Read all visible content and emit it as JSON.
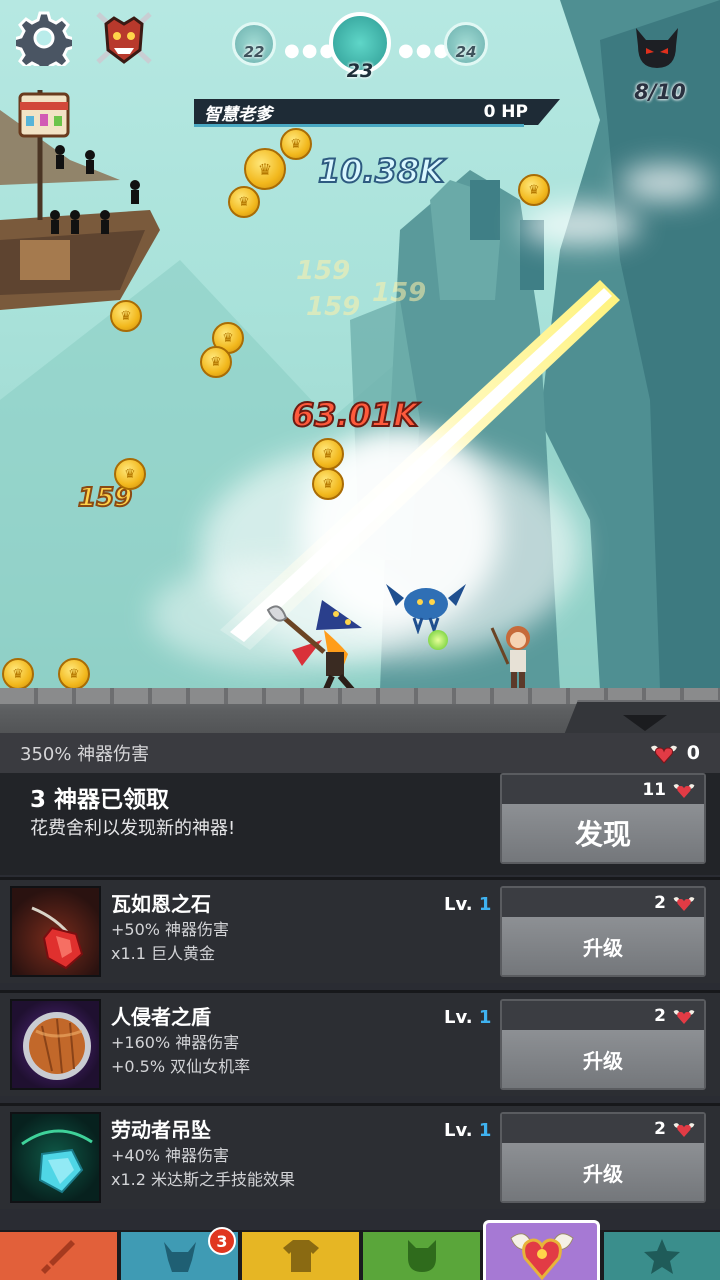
{
  "hud": {
    "stages": {
      "prev": "22",
      "current": "23",
      "next": "24"
    },
    "stage_progress": "8/10",
    "boss_name": "智慧老爹",
    "boss_hp": "0 HP"
  },
  "combat_text": {
    "top_damage": "10.38K",
    "crit_damage": "63.01K",
    "hit_damage": "159",
    "faded_hits": [
      "159",
      "159",
      "159"
    ]
  },
  "artifact_panel": {
    "damage_bonus": "350% 神器伤害",
    "relic_count": "0",
    "discover": {
      "title": "3 神器已领取",
      "subtitle": "花费舍利以发现新的神器!",
      "cost": "11",
      "button_label": "发现"
    },
    "artifacts": [
      {
        "name": "瓦如恩之石",
        "line1": "+50% 神器伤害",
        "line2": "x1.1 巨人黄金",
        "level_prefix": "Lv.",
        "level": "1",
        "cost": "2",
        "button_label": "升级"
      },
      {
        "name": "人侵者之盾",
        "line1": "+160% 神器伤害",
        "line2": "+0.5% 双仙女机率",
        "level_prefix": "Lv.",
        "level": "1",
        "cost": "2",
        "button_label": "升级"
      },
      {
        "name": "劳动者吊坠",
        "line1": "+40% 神器伤害",
        "line2": "x1.2 米达斯之手技能效果",
        "level_prefix": "Lv.",
        "level": "1",
        "cost": "2",
        "button_label": "升级"
      }
    ]
  },
  "tabs": {
    "hero_badge": "3",
    "items": [
      {
        "name": "sword-icon",
        "color": "#e2603a"
      },
      {
        "name": "viking-helmet-icon",
        "color": "#3f9bb4"
      },
      {
        "name": "shirt-icon",
        "color": "#e6b624"
      },
      {
        "name": "pet-icon",
        "color": "#5aa63a"
      },
      {
        "name": "winged-heart-icon",
        "color": "#a679d4"
      },
      {
        "name": "star-icon",
        "color": "#3a8e8c"
      }
    ]
  },
  "colors": {
    "level_number": "#3fb2f0",
    "relic_heart": "#e23b45"
  }
}
